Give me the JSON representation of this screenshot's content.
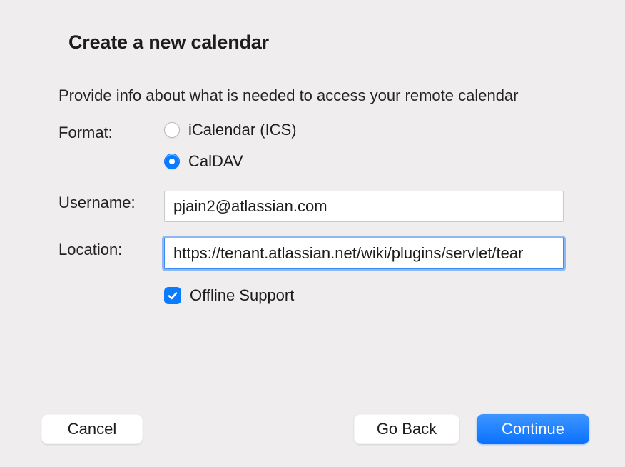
{
  "title": "Create a new calendar",
  "description": "Provide info about what is needed to access your remote calendar",
  "labels": {
    "format": "Format:",
    "username": "Username:",
    "location": "Location:"
  },
  "format_options": {
    "icalendar": {
      "label": "iCalendar (ICS)",
      "selected": false
    },
    "caldav": {
      "label": "CalDAV",
      "selected": true
    }
  },
  "fields": {
    "username": {
      "value": "pjain2@atlassian.com"
    },
    "location": {
      "value": "https://tenant.atlassian.net/wiki/plugins/servlet/tear"
    }
  },
  "offline_support": {
    "label": "Offline Support",
    "checked": true
  },
  "buttons": {
    "cancel": "Cancel",
    "go_back": "Go Back",
    "continue": "Continue"
  }
}
